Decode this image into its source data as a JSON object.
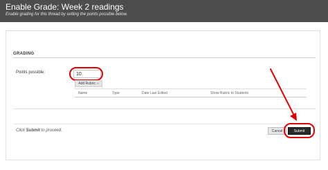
{
  "header": {
    "title": "Enable Grade: Week 2 readings",
    "subtitle": "Enable grading for this thread by setting the points possible below."
  },
  "grading": {
    "section_title": "GRADING",
    "points_label": "Points possible:",
    "points_value": "10",
    "add_rubric_label": "Add Rubric",
    "add_rubric_chevron": "»",
    "columns": [
      "Name",
      "Type",
      "Date Last Edited",
      "Show Rubric to Students"
    ]
  },
  "footer": {
    "hint_prefix": "Click ",
    "hint_bold": "Submit",
    "hint_suffix": " to proceed.",
    "cancel_label": "Cancel",
    "submit_label": "Submit"
  },
  "annotations": {
    "highlight_color": "#e00000"
  },
  "colors": {
    "header_bg": "#4d4d4d",
    "submit_bg": "#2b2b2b",
    "button_bg": "#e8e8e8"
  }
}
